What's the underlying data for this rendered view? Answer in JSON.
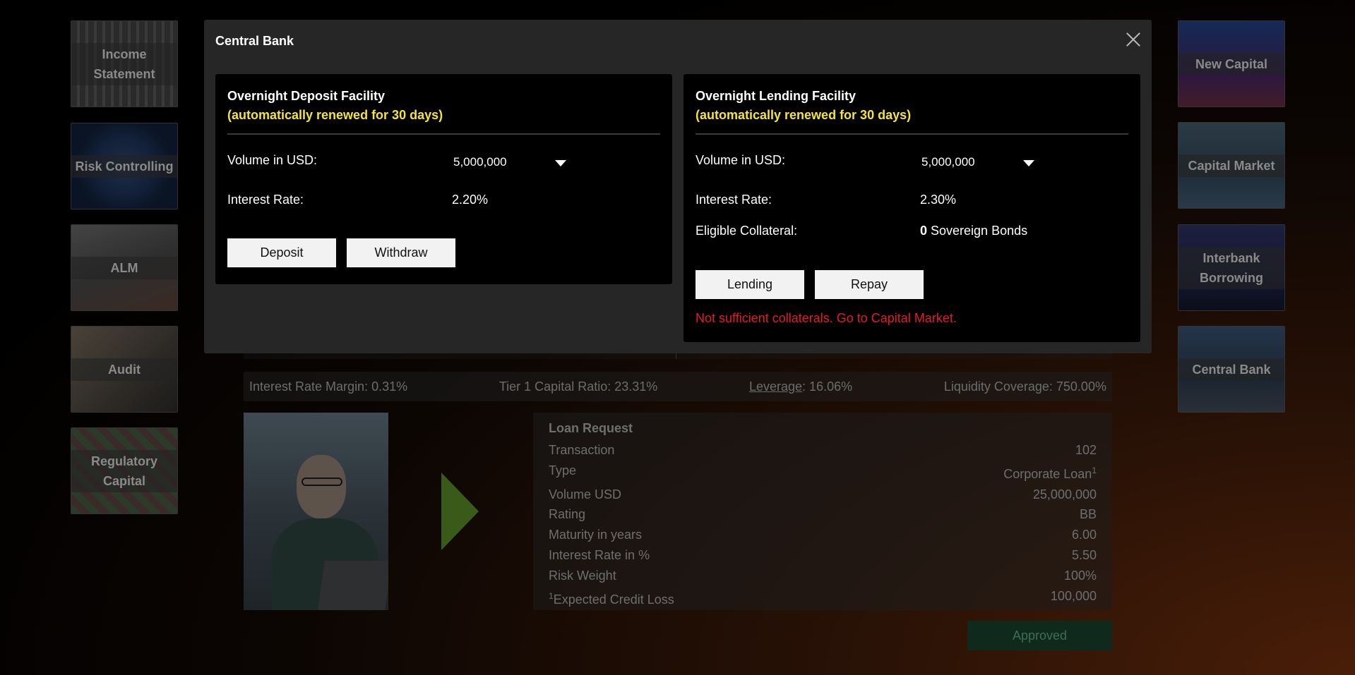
{
  "left_nav": [
    {
      "label": "Income Statement"
    },
    {
      "label": "Risk Controlling"
    },
    {
      "label": "ALM"
    },
    {
      "label": "Audit"
    },
    {
      "label": "Regulatory Capital"
    }
  ],
  "right_nav": [
    {
      "label": "New Capital"
    },
    {
      "label": "Capital Market"
    },
    {
      "label": "Interbank Borrowing"
    },
    {
      "label": "Central Bank"
    }
  ],
  "metrics": {
    "interest_margin": "Interest Rate Margin: 0.31%",
    "tier1": "Tier 1 Capital Ratio: 23.31%",
    "leverage_label": "Leverage",
    "leverage_value": ": 16.06%",
    "liquidity": "Liquidity Coverage: 750.00%"
  },
  "loan": {
    "title": "Loan Request",
    "rows": [
      {
        "label": "Transaction",
        "value": "102"
      },
      {
        "label": "Type",
        "value": "Corporate Loan",
        "sup": "1"
      },
      {
        "label": "Volume USD",
        "value": "25,000,000"
      },
      {
        "label": "Rating",
        "value": "BB"
      },
      {
        "label": "Maturity in years",
        "value": "6.00"
      },
      {
        "label": "Interest Rate in %",
        "value": "5.50"
      },
      {
        "label": "Risk Weight",
        "value": "100%"
      },
      {
        "label": "Expected Credit Loss",
        "value": "100,000",
        "pre_sup": "1"
      }
    ],
    "approved_label": "Approved"
  },
  "modal": {
    "title": "Central Bank",
    "deposit": {
      "heading": "Overnight Deposit Facility",
      "subheading": "(automatically renewed for 30 days)",
      "volume_label": "Volume in USD:",
      "volume_value": "5,000,000",
      "rate_label": "Interest Rate:",
      "rate_value": "2.20%",
      "deposit_btn": "Deposit",
      "withdraw_btn": "Withdraw"
    },
    "lending": {
      "heading": "Overnight Lending Facility",
      "subheading": "(automatically renewed for 30 days)",
      "volume_label": "Volume in USD:",
      "volume_value": "5,000,000",
      "rate_label": "Interest Rate:",
      "rate_value": "2.30%",
      "collateral_label": "Eligible Collateral:",
      "collateral_count": "0",
      "collateral_unit": " Sovereign Bonds",
      "lending_btn": "Lending",
      "repay_btn": "Repay",
      "error": "Not sufficient collaterals. Go to Capital Market."
    }
  }
}
